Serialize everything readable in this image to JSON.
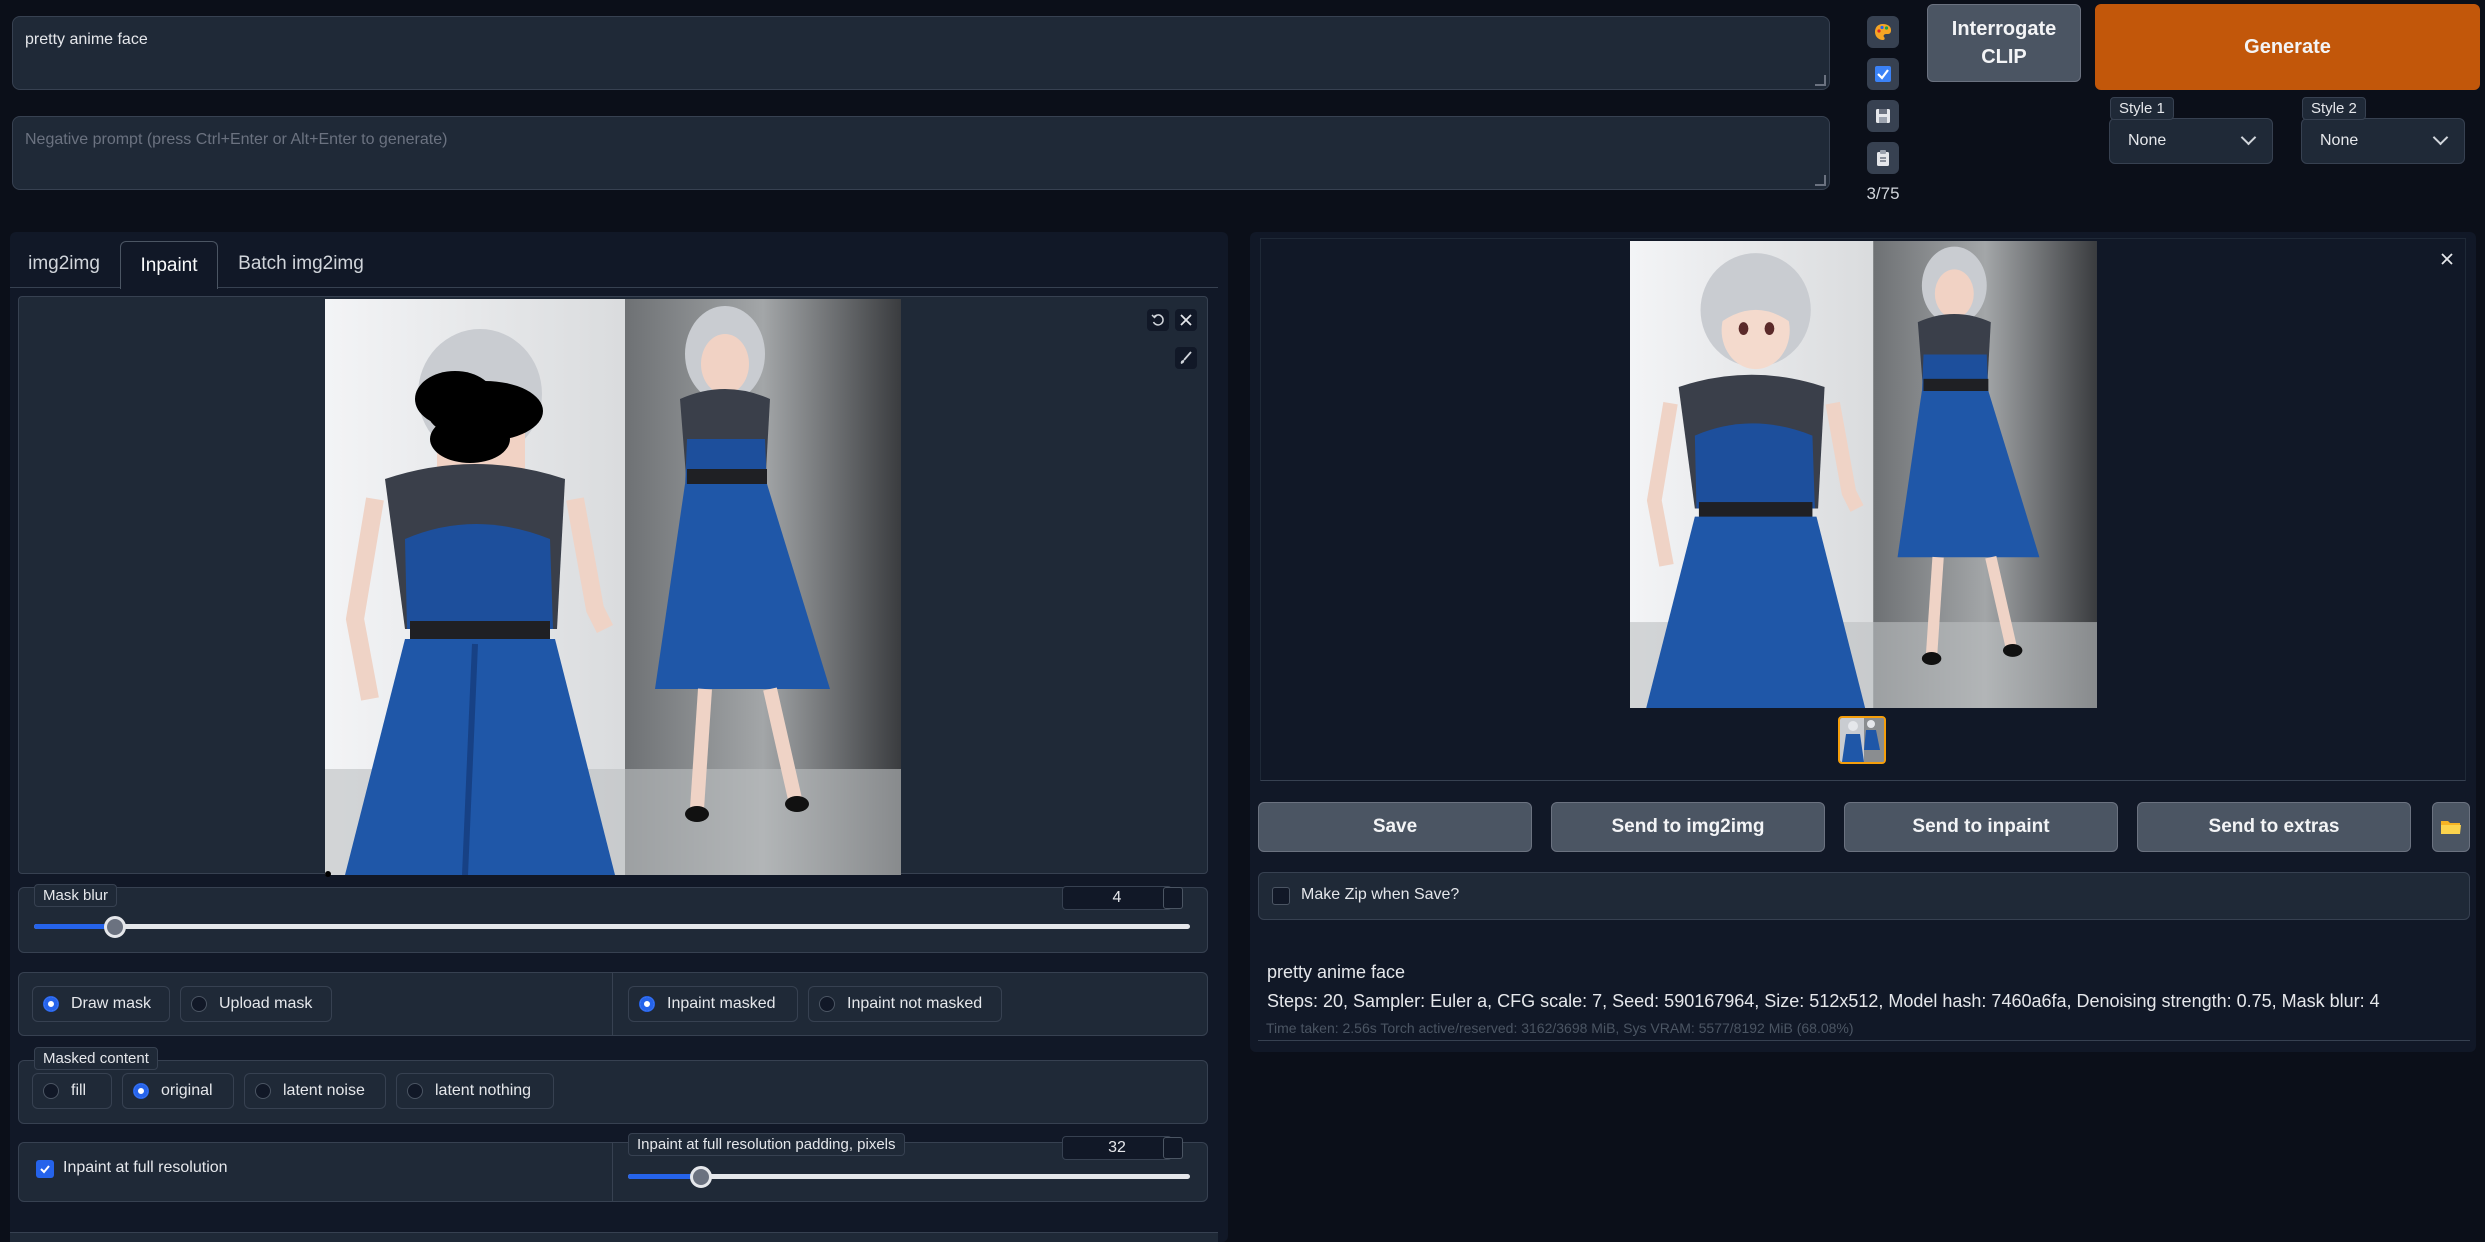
{
  "prompt": {
    "value": "pretty anime face"
  },
  "negative_prompt": {
    "placeholder": "Negative prompt (press Ctrl+Enter or Alt+Enter to generate)"
  },
  "token_counter": "3/75",
  "tool_icons": [
    "palette-icon",
    "checkbox-icon",
    "save-icon",
    "clipboard-icon"
  ],
  "interrogate_label": "Interrogate CLIP",
  "generate_label": "Generate",
  "styles": [
    {
      "label": "Style 1",
      "value": "None"
    },
    {
      "label": "Style 2",
      "value": "None"
    }
  ],
  "tabs": [
    "img2img",
    "Inpaint",
    "Batch img2img"
  ],
  "active_tab": "Inpaint",
  "mask_blur": {
    "label": "Mask blur",
    "value": "4",
    "fraction": 0.07
  },
  "mask_mode": {
    "options": [
      "Draw mask",
      "Upload mask"
    ],
    "selected": "Draw mask"
  },
  "inpaint_mode": {
    "options": [
      "Inpaint masked",
      "Inpaint not masked"
    ],
    "selected": "Inpaint masked"
  },
  "masked_content": {
    "label": "Masked content",
    "options": [
      "fill",
      "original",
      "latent noise",
      "latent nothing"
    ],
    "selected": "original"
  },
  "full_res": {
    "label": "Inpaint at full resolution",
    "checked": true
  },
  "padding": {
    "label": "Inpaint at full resolution padding, pixels",
    "value": "32",
    "fraction": 0.13
  },
  "actions": [
    "Save",
    "Send to img2img",
    "Send to inpaint",
    "Send to extras"
  ],
  "make_zip_label": "Make Zip when Save?",
  "output_info": {
    "prompt": "pretty anime face",
    "params": "Steps: 20, Sampler: Euler a, CFG scale: 7, Seed: 590167964, Size: 512x512, Model hash: 7460a6fa, Denoising strength: 0.75, Mask blur: 4",
    "timing": "Time taken: 2.56s  Torch active/reserved: 3162/3698 MiB, Sys VRAM: 5577/8192 MiB (68.08%)"
  },
  "colors": {
    "accent": "#2563eb",
    "generate": "#c2570a",
    "background": "#0b0f19"
  }
}
